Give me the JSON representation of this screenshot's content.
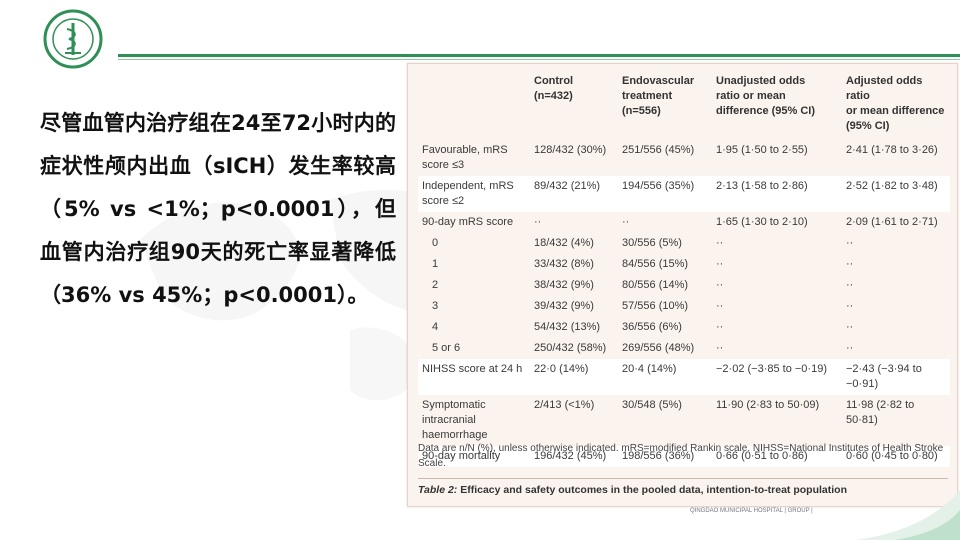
{
  "header": {
    "logo_icon": "hospital-seal-icon",
    "accent": "#2f8f56"
  },
  "main_text": "尽管血管内治疗组在24至72小时内的症状性颅内出血（sICH）发生率较高（5% vs <1%；p<0.0001），但血管内治疗组90天的死亡率显著降低（36% vs 45%；p<0.0001）。",
  "table": {
    "headers": [
      "",
      "Control\n(n=432)",
      "Endovascular\ntreatment\n(n=556)",
      "Unadjusted odds\nratio or mean\ndifference (95% CI)",
      "Adjusted odds ratio\nor mean difference\n(95% CI)"
    ],
    "rows": [
      [
        "Favourable, mRS\nscore ≤3",
        "128/432 (30%)",
        "251/556 (45%)",
        "1·95 (1·50 to 2·55)",
        "2·41 (1·78 to 3·26)"
      ],
      [
        "Independent, mRS\nscore ≤2",
        "89/432 (21%)",
        "194/556 (35%)",
        "2·13 (1·58 to 2·86)",
        "2·52 (1·82 to 3·48)"
      ],
      [
        "90-day mRS score",
        "··",
        "··",
        "1·65 (1·30 to 2·10)",
        "2·09 (1·61 to 2·71)"
      ],
      [
        "0",
        "18/432 (4%)",
        "30/556 (5%)",
        "··",
        "··"
      ],
      [
        "1",
        "33/432 (8%)",
        "84/556 (15%)",
        "··",
        "··"
      ],
      [
        "2",
        "38/432 (9%)",
        "80/556 (14%)",
        "··",
        "··"
      ],
      [
        "3",
        "39/432 (9%)",
        "57/556 (10%)",
        "··",
        "··"
      ],
      [
        "4",
        "54/432 (13%)",
        "36/556 (6%)",
        "··",
        "··"
      ],
      [
        "5 or 6",
        "250/432 (58%)",
        "269/556 (48%)",
        "··",
        "··"
      ],
      [
        "NIHSS score at 24 h",
        "22·0 (14%)",
        "20·4 (14%)",
        "−2·02 (−3·85 to −0·19)",
        "−2·43 (−3·94 to −0·91)"
      ],
      [
        "Symptomatic\nintracranial\nhaemorrhage",
        "2/413 (<1%)",
        "30/548 (5%)",
        "11·90 (2·83 to 50·09)",
        "11·98 (2·82 to 50·81)"
      ],
      [
        "90-day mortality",
        "196/432 (45%)",
        "198/556 (36%)",
        "0·66 (0·51 to 0·86)",
        "0·60 (0·45 to 0·80)"
      ]
    ],
    "note": "Data are n/N (%), unless otherwise indicated. mRS=modified Rankin scale. NIHSS=National Institutes of Health Stroke Scale.",
    "caption_label": "Table 2:",
    "caption_text": " Efficacy and safety outcomes in the pooled data, intention-to-treat population"
  },
  "footer": {
    "text": "QINGDAO MUNICIPAL HOSPITAL | GROUP |"
  }
}
